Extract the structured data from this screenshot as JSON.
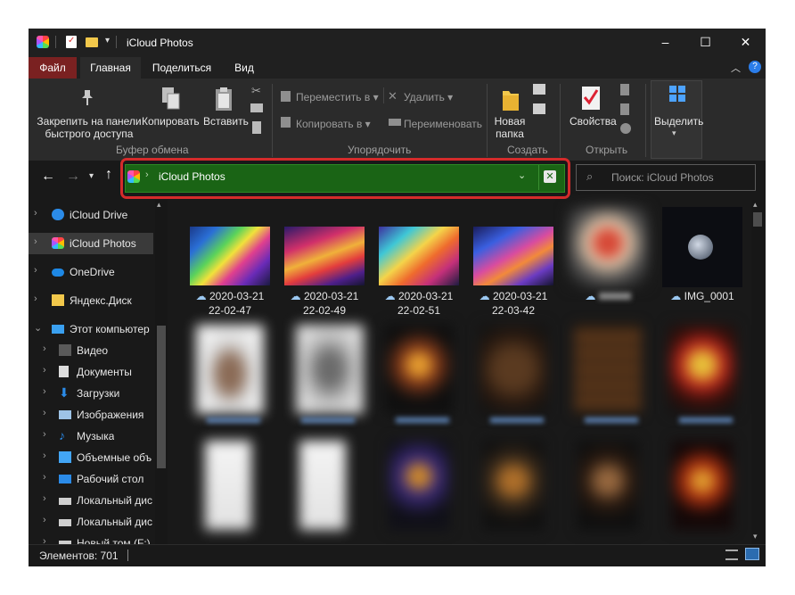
{
  "window": {
    "title": "iCloud Photos",
    "controls": {
      "minimize": "–",
      "maximize": "☐",
      "close": "✕"
    }
  },
  "ribbon_tabs": [
    {
      "label": "Файл"
    },
    {
      "label": "Главная"
    },
    {
      "label": "Поделиться"
    },
    {
      "label": "Вид"
    }
  ],
  "ribbon": {
    "pin_line1": "Закрепить на панели",
    "pin_line2": "быстрого доступа",
    "copy": "Копировать",
    "paste": "Вставить",
    "clipboard_group": "Буфер обмена",
    "move_to": "Переместить в",
    "copy_to": "Копировать в",
    "delete": "Удалить",
    "rename": "Переименовать",
    "organize_group": "Упорядочить",
    "new_folder_line1": "Новая",
    "new_folder_line2": "папка",
    "create_group": "Создать",
    "properties": "Свойства",
    "open_group": "Открыть",
    "select": "Выделить"
  },
  "address": {
    "path": "iCloud Photos",
    "search_placeholder": "Поиск: iCloud Photos"
  },
  "sidebar": {
    "items": [
      {
        "label": "iCloud Drive"
      },
      {
        "label": "iCloud Photos"
      },
      {
        "label": "OneDrive"
      },
      {
        "label": "Яндекс.Диск"
      },
      {
        "label": "Этот компьютер"
      },
      {
        "label": "Видео"
      },
      {
        "label": "Документы"
      },
      {
        "label": "Загрузки"
      },
      {
        "label": "Изображения"
      },
      {
        "label": "Музыка"
      },
      {
        "label": "Объемные объ"
      },
      {
        "label": "Рабочий стол"
      },
      {
        "label": "Локальный дис"
      },
      {
        "label": "Локальный дис"
      },
      {
        "label": "Новый том (F:)"
      }
    ]
  },
  "files": [
    {
      "line1": "2020-03-21",
      "line2": "22-02-47"
    },
    {
      "line1": "2020-03-21",
      "line2": "22-02-49"
    },
    {
      "line1": "2020-03-21",
      "line2": "22-02-51"
    },
    {
      "line1": "2020-03-21",
      "line2": "22-03-42"
    },
    {
      "line1": "",
      "line2": ""
    },
    {
      "line1": "IMG_0001",
      "line2": ""
    }
  ],
  "status": {
    "items_count": "Элементов: 701"
  },
  "colors": {
    "address_bar": "#1a6415",
    "highlight_ring": "#d42b2b",
    "file_tab": "#7a2121",
    "background": "#191919"
  }
}
